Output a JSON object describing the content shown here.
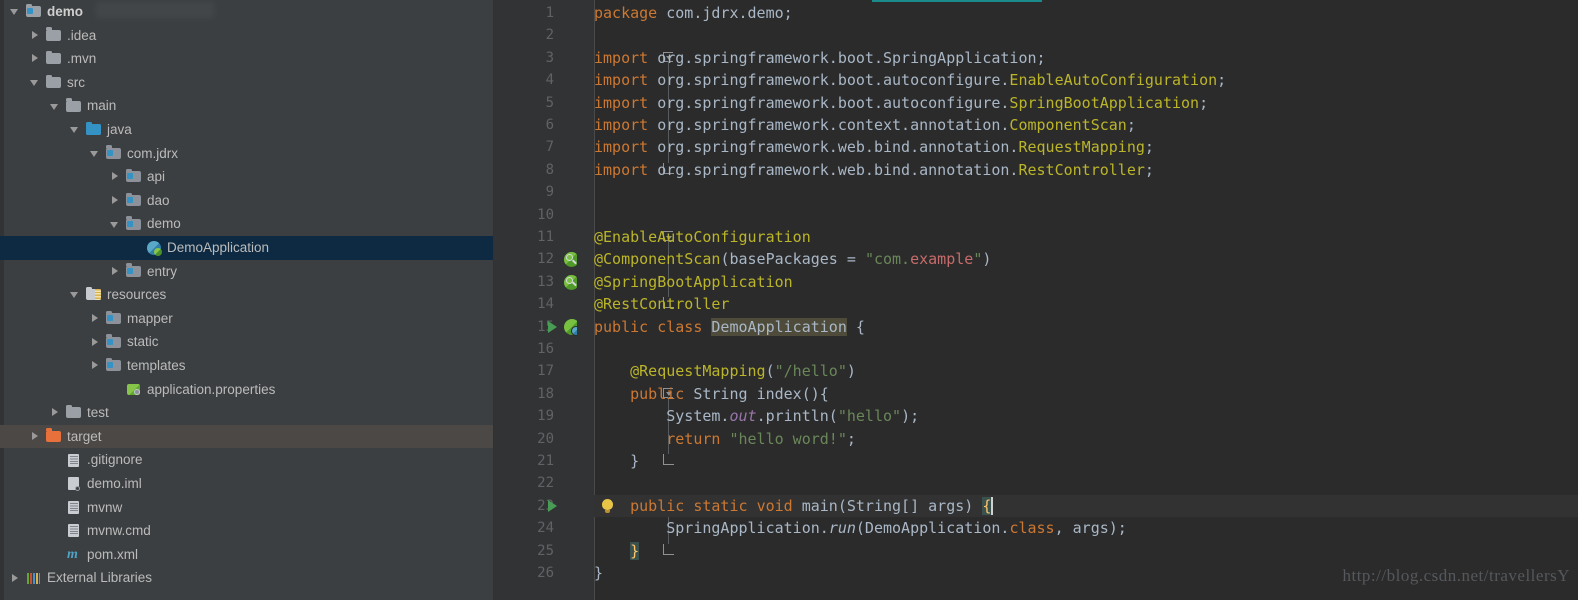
{
  "window": {
    "theme": "darcula",
    "accent_teal": "#1b8a8a",
    "editor_bg": "#2b2b2b",
    "sidebar_bg": "#3c3f41",
    "gutter_bg": "#313335",
    "selection_bg": "#0d2a42",
    "hover_bg": "#4b4845"
  },
  "sidebar": {
    "name": "project-tree",
    "items": [
      {
        "label": "demo",
        "indent": 0,
        "twisty": "expanded",
        "icon": "module-folder-icon",
        "bold": true,
        "selected": false,
        "hovered": false
      },
      {
        "label": ".idea",
        "indent": 1,
        "twisty": "collapsed",
        "icon": "folder-icon",
        "bold": false,
        "selected": false,
        "hovered": false
      },
      {
        "label": ".mvn",
        "indent": 1,
        "twisty": "collapsed",
        "icon": "folder-icon",
        "bold": false,
        "selected": false,
        "hovered": false
      },
      {
        "label": "src",
        "indent": 1,
        "twisty": "expanded",
        "icon": "folder-icon",
        "bold": false,
        "selected": false,
        "hovered": false
      },
      {
        "label": "main",
        "indent": 2,
        "twisty": "expanded",
        "icon": "folder-icon",
        "bold": false,
        "selected": false,
        "hovered": false
      },
      {
        "label": "java",
        "indent": 3,
        "twisty": "expanded",
        "icon": "source-root-icon",
        "bold": false,
        "selected": false,
        "hovered": false
      },
      {
        "label": "com.jdrx",
        "indent": 4,
        "twisty": "expanded",
        "icon": "package-icon",
        "bold": false,
        "selected": false,
        "hovered": false
      },
      {
        "label": "api",
        "indent": 5,
        "twisty": "collapsed",
        "icon": "package-icon",
        "bold": false,
        "selected": false,
        "hovered": false
      },
      {
        "label": "dao",
        "indent": 5,
        "twisty": "collapsed",
        "icon": "package-icon",
        "bold": false,
        "selected": false,
        "hovered": false
      },
      {
        "label": "demo",
        "indent": 5,
        "twisty": "expanded",
        "icon": "package-icon",
        "bold": false,
        "selected": false,
        "hovered": false
      },
      {
        "label": "DemoApplication",
        "indent": 6,
        "twisty": "none",
        "icon": "spring-class-icon",
        "bold": false,
        "selected": true,
        "hovered": false
      },
      {
        "label": "entry",
        "indent": 5,
        "twisty": "collapsed",
        "icon": "package-icon",
        "bold": false,
        "selected": false,
        "hovered": false
      },
      {
        "label": "resources",
        "indent": 3,
        "twisty": "expanded",
        "icon": "resources-folder-icon",
        "bold": false,
        "selected": false,
        "hovered": false
      },
      {
        "label": "mapper",
        "indent": 4,
        "twisty": "collapsed",
        "icon": "package-icon",
        "bold": false,
        "selected": false,
        "hovered": false
      },
      {
        "label": "static",
        "indent": 4,
        "twisty": "collapsed",
        "icon": "package-icon",
        "bold": false,
        "selected": false,
        "hovered": false
      },
      {
        "label": "templates",
        "indent": 4,
        "twisty": "collapsed",
        "icon": "package-icon",
        "bold": false,
        "selected": false,
        "hovered": false
      },
      {
        "label": "application.properties",
        "indent": 5,
        "twisty": "none",
        "icon": "properties-file-icon",
        "bold": false,
        "selected": false,
        "hovered": false
      },
      {
        "label": "test",
        "indent": 2,
        "twisty": "collapsed",
        "icon": "folder-icon",
        "bold": false,
        "selected": false,
        "hovered": false
      },
      {
        "label": "target",
        "indent": 1,
        "twisty": "collapsed",
        "icon": "excluded-folder-icon",
        "bold": false,
        "selected": false,
        "hovered": true
      },
      {
        "label": ".gitignore",
        "indent": 2,
        "twisty": "none",
        "icon": "text-file-icon",
        "bold": false,
        "selected": false,
        "hovered": false
      },
      {
        "label": "demo.iml",
        "indent": 2,
        "twisty": "none",
        "icon": "iml-file-icon",
        "bold": false,
        "selected": false,
        "hovered": false
      },
      {
        "label": "mvnw",
        "indent": 2,
        "twisty": "none",
        "icon": "text-file-icon",
        "bold": false,
        "selected": false,
        "hovered": false
      },
      {
        "label": "mvnw.cmd",
        "indent": 2,
        "twisty": "none",
        "icon": "text-file-icon",
        "bold": false,
        "selected": false,
        "hovered": false
      },
      {
        "label": "pom.xml",
        "indent": 2,
        "twisty": "none",
        "icon": "maven-file-icon",
        "bold": false,
        "selected": false,
        "hovered": false
      },
      {
        "label": "External Libraries",
        "indent": 0,
        "twisty": "collapsed",
        "icon": "libraries-icon",
        "bold": false,
        "selected": false,
        "hovered": false
      }
    ]
  },
  "editor": {
    "language": "java",
    "file": "DemoApplication",
    "caret_line": 23,
    "lines": [
      {
        "n": 1,
        "tokens": [
          {
            "t": "package",
            "c": "kw"
          },
          {
            "t": " com.jdrx.demo;",
            "c": "txt"
          }
        ],
        "indent": 0,
        "gutter": null,
        "fold": null
      },
      {
        "n": 2,
        "tokens": [],
        "indent": 0,
        "gutter": null,
        "fold": null
      },
      {
        "n": 3,
        "tokens": [
          {
            "t": "import",
            "c": "kw"
          },
          {
            "t": " org.springframework.boot.",
            "c": "txt"
          },
          {
            "t": "SpringApplication",
            "c": "txt"
          },
          {
            "t": ";",
            "c": "txt"
          }
        ],
        "indent": 0,
        "gutter": null,
        "fold": "open"
      },
      {
        "n": 4,
        "tokens": [
          {
            "t": "import",
            "c": "kw"
          },
          {
            "t": " org.springframework.boot.autoconfigure.",
            "c": "txt"
          },
          {
            "t": "EnableAutoConfiguration",
            "c": "ann"
          },
          {
            "t": ";",
            "c": "txt"
          }
        ],
        "indent": 0,
        "gutter": null,
        "fold": null
      },
      {
        "n": 5,
        "tokens": [
          {
            "t": "import",
            "c": "kw"
          },
          {
            "t": " org.springframework.boot.autoconfigure.",
            "c": "txt"
          },
          {
            "t": "SpringBootApplication",
            "c": "ann"
          },
          {
            "t": ";",
            "c": "txt"
          }
        ],
        "indent": 0,
        "gutter": null,
        "fold": null
      },
      {
        "n": 6,
        "tokens": [
          {
            "t": "import",
            "c": "kw"
          },
          {
            "t": " org.springframework.context.annotation.",
            "c": "txt"
          },
          {
            "t": "ComponentScan",
            "c": "ann"
          },
          {
            "t": ";",
            "c": "txt"
          }
        ],
        "indent": 0,
        "gutter": null,
        "fold": null
      },
      {
        "n": 7,
        "tokens": [
          {
            "t": "import",
            "c": "kw"
          },
          {
            "t": " org.springframework.web.bind.annotation.",
            "c": "txt"
          },
          {
            "t": "RequestMapping",
            "c": "ann"
          },
          {
            "t": ";",
            "c": "txt"
          }
        ],
        "indent": 0,
        "gutter": null,
        "fold": null
      },
      {
        "n": 8,
        "tokens": [
          {
            "t": "import",
            "c": "kw"
          },
          {
            "t": " org.springframework.web.bind.annotation.",
            "c": "txt"
          },
          {
            "t": "RestController",
            "c": "ann"
          },
          {
            "t": ";",
            "c": "txt"
          }
        ],
        "indent": 0,
        "gutter": null,
        "fold": "end"
      },
      {
        "n": 9,
        "tokens": [],
        "indent": 0,
        "gutter": null,
        "fold": null
      },
      {
        "n": 10,
        "tokens": [],
        "indent": 0,
        "gutter": null,
        "fold": null
      },
      {
        "n": 11,
        "tokens": [
          {
            "t": "@EnableAutoConfiguration",
            "c": "ann"
          }
        ],
        "indent": 0,
        "gutter": null,
        "fold": "open"
      },
      {
        "n": 12,
        "tokens": [
          {
            "t": "@ComponentScan",
            "c": "ann"
          },
          {
            "t": "(",
            "c": "txt"
          },
          {
            "t": "basePackages",
            "c": "txt"
          },
          {
            "t": " = ",
            "c": "txt"
          },
          {
            "t": "\"com.",
            "c": "str"
          },
          {
            "t": "example",
            "c": "red"
          },
          {
            "t": "\"",
            "c": "str"
          },
          {
            "t": ")",
            "c": "txt"
          }
        ],
        "indent": 0,
        "gutter": "bean",
        "fold": null
      },
      {
        "n": 13,
        "tokens": [
          {
            "t": "@SpringBootApplication",
            "c": "ann"
          }
        ],
        "indent": 0,
        "gutter": "bean",
        "fold": null
      },
      {
        "n": 14,
        "tokens": [
          {
            "t": "@RestController",
            "c": "ann"
          }
        ],
        "indent": 0,
        "gutter": null,
        "fold": "end"
      },
      {
        "n": 15,
        "tokens": [
          {
            "t": "public",
            "c": "kw"
          },
          {
            "t": " ",
            "c": "txt"
          },
          {
            "t": "class",
            "c": "kw"
          },
          {
            "t": " ",
            "c": "txt"
          },
          {
            "t": "DemoApplication",
            "c": "ident-hl"
          },
          {
            "t": " {",
            "c": "txt"
          }
        ],
        "indent": 0,
        "gutter": "run-spring",
        "fold": null
      },
      {
        "n": 16,
        "tokens": [],
        "indent": 0,
        "gutter": null,
        "fold": null
      },
      {
        "n": 17,
        "tokens": [
          {
            "t": "    ",
            "c": "txt"
          },
          {
            "t": "@RequestMapping",
            "c": "ann"
          },
          {
            "t": "(",
            "c": "txt"
          },
          {
            "t": "\"/hello\"",
            "c": "str"
          },
          {
            "t": ")",
            "c": "txt"
          }
        ],
        "indent": 1,
        "gutter": null,
        "fold": null
      },
      {
        "n": 18,
        "tokens": [
          {
            "t": "    ",
            "c": "txt"
          },
          {
            "t": "public",
            "c": "kw"
          },
          {
            "t": " String ",
            "c": "txt"
          },
          {
            "t": "index",
            "c": "txt"
          },
          {
            "t": "(){",
            "c": "txt"
          }
        ],
        "indent": 1,
        "gutter": null,
        "fold": "open"
      },
      {
        "n": 19,
        "tokens": [
          {
            "t": "        ",
            "c": "txt"
          },
          {
            "t": "System.",
            "c": "txt"
          },
          {
            "t": "out",
            "c": "fld"
          },
          {
            "t": ".println(",
            "c": "txt"
          },
          {
            "t": "\"hello\"",
            "c": "str"
          },
          {
            "t": ");",
            "c": "txt"
          }
        ],
        "indent": 2,
        "gutter": null,
        "fold": null
      },
      {
        "n": 20,
        "tokens": [
          {
            "t": "        ",
            "c": "txt"
          },
          {
            "t": "return",
            "c": "kw"
          },
          {
            "t": " ",
            "c": "txt"
          },
          {
            "t": "\"hello word!\"",
            "c": "str"
          },
          {
            "t": ";",
            "c": "txt"
          }
        ],
        "indent": 2,
        "gutter": null,
        "fold": null
      },
      {
        "n": 21,
        "tokens": [
          {
            "t": "    }",
            "c": "txt"
          }
        ],
        "indent": 1,
        "gutter": null,
        "fold": "end"
      },
      {
        "n": 22,
        "tokens": [],
        "indent": 0,
        "gutter": null,
        "fold": null
      },
      {
        "n": 23,
        "tokens": [
          {
            "t": "    ",
            "c": "txt"
          },
          {
            "t": "public",
            "c": "kw"
          },
          {
            "t": " ",
            "c": "txt"
          },
          {
            "t": "static",
            "c": "kw"
          },
          {
            "t": " ",
            "c": "txt"
          },
          {
            "t": "void",
            "c": "kw"
          },
          {
            "t": " ",
            "c": "txt"
          },
          {
            "t": "main",
            "c": "txt"
          },
          {
            "t": "(String[] args) ",
            "c": "txt"
          },
          {
            "t": "{",
            "c": "brace-hl"
          }
        ],
        "indent": 1,
        "gutter": "run-bulb",
        "fold": "open"
      },
      {
        "n": 24,
        "tokens": [
          {
            "t": "        ",
            "c": "txt"
          },
          {
            "t": "SpringApplication.",
            "c": "txt"
          },
          {
            "t": "run",
            "c": "stat"
          },
          {
            "t": "(DemoApplication.",
            "c": "txt"
          },
          {
            "t": "class",
            "c": "kw"
          },
          {
            "t": ", args);",
            "c": "txt"
          }
        ],
        "indent": 2,
        "gutter": null,
        "fold": null
      },
      {
        "n": 25,
        "tokens": [
          {
            "t": "    ",
            "c": "txt"
          },
          {
            "t": "}",
            "c": "brace-hl"
          }
        ],
        "indent": 1,
        "gutter": null,
        "fold": "end"
      },
      {
        "n": 26,
        "tokens": [
          {
            "t": "}",
            "c": "txt"
          }
        ],
        "indent": 0,
        "gutter": null,
        "fold": null
      }
    ]
  },
  "watermark": {
    "text": "http://blog.csdn.net/travellersY"
  }
}
